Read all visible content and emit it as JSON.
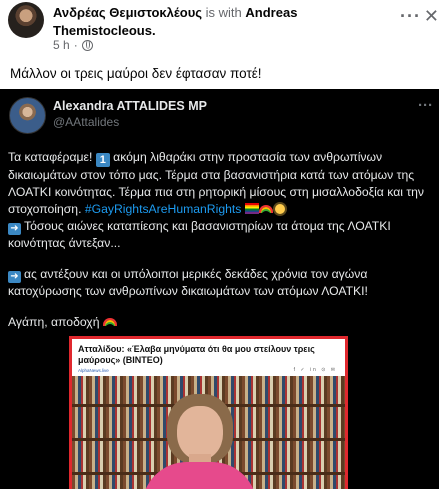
{
  "post": {
    "author": "Ανδρέας Θεμιστοκλέους",
    "with_text": "is with",
    "tagged": "Andreas Themistocleous.",
    "time": "5 h",
    "text": "Μάλλον οι τρεις μαύροι δεν έφτασαν ποτέ!"
  },
  "tweet": {
    "name": "Alexandra ATTALIDES MP",
    "handle": "@AAttalides",
    "line1a": "Τα καταφέραμε!",
    "line1b": "ακόμη λιθαράκι στην προστασία των ανθρωπίνων δικαιωμάτων στον τόπο μας. Τέρμα στα βασανιστήρια κατά των ατόμων της ΛΟΑΤΚΙ κοινότητας. Τέρμα πια στη ρητορική μίσους στη μισαλλοδοξία και την στοχοποίηση.",
    "hashtag": "#GayRightsAreHumanRights",
    "para2": "Τόσους αιώνες καταπίεσης και βασανιστηρίων τα άτομα της ΛΟΑΤΚΙ κοινότητας άντεξαν...",
    "para3": "ας αντέξουν και οι υπόλοιποι μερικές δεκάδες χρόνια τον αγώνα κατοχύρωσης των ανθρωπίνων δικαιωμάτων  των ατόμων ΛΟΑΤΚΙ!",
    "para4": "Αγάπη, αποδοχή"
  },
  "news_card": {
    "title": "Ατταλίδου: «Έλαβα μηνύματα ότι θα μου στείλουν τρεις μαύρους» (ΒΙΝΤΕΟ)",
    "source": "AlphaNews.live"
  },
  "icons": {
    "more": "more-options-icon",
    "close": "close-icon",
    "globe": "globe-icon"
  }
}
